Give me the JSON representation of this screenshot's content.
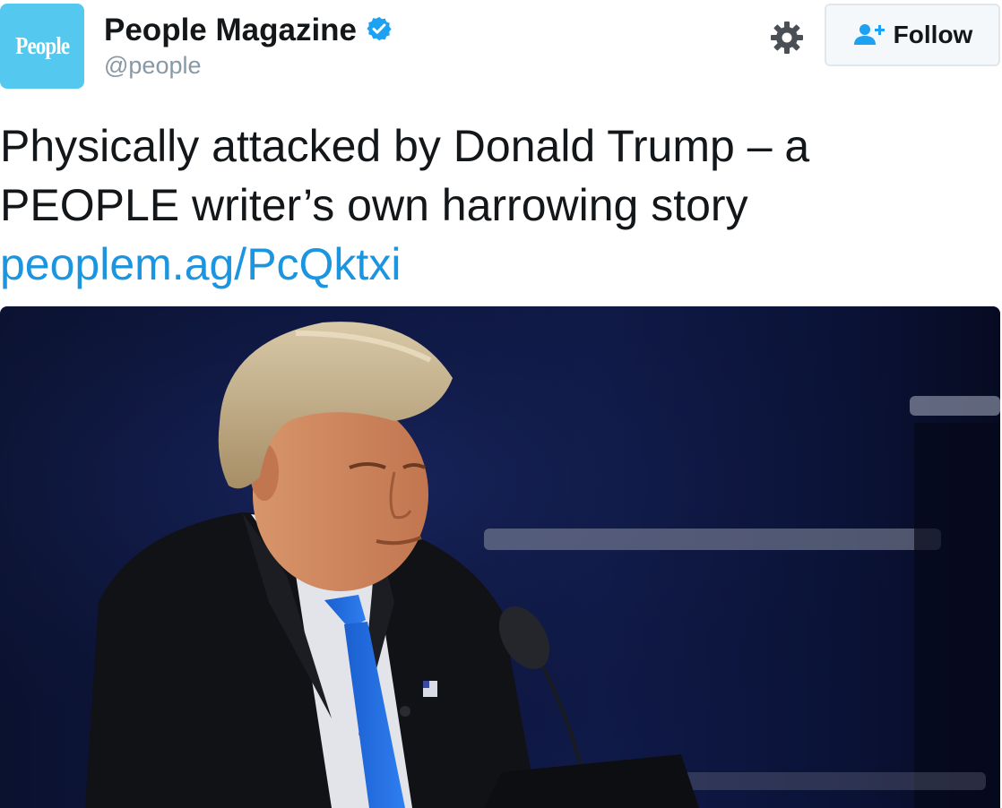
{
  "account": {
    "avatar_text": "People",
    "display_name": "People Magazine",
    "handle": "@people",
    "verified": true
  },
  "actions": {
    "settings_icon": "gear-icon",
    "follow_label": "Follow",
    "follow_icon": "add-user-icon"
  },
  "tweet": {
    "text": "Physically attacked by Donald Trump – a PEOPLE writer’s own harrowing story",
    "link": "peoplem.ag/PcQktxi"
  },
  "colors": {
    "avatar_bg": "#55c8f0",
    "link": "#1b95e0",
    "verified": "#1da1f2",
    "handle": "#8899a6",
    "tie": "#1a5fd0"
  }
}
